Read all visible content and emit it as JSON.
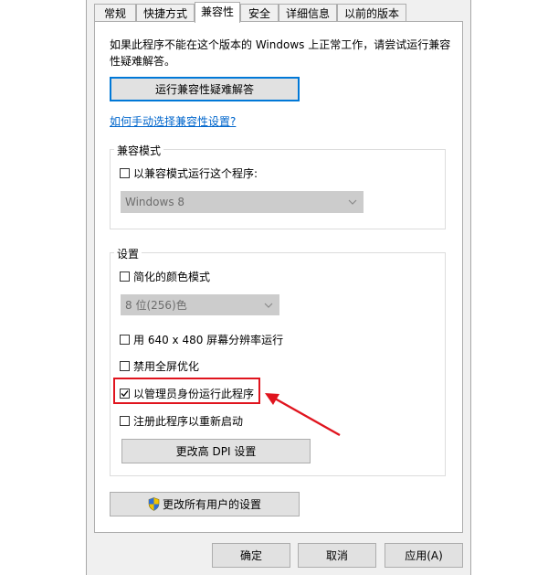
{
  "tabs": [
    {
      "label": "常规"
    },
    {
      "label": "快捷方式"
    },
    {
      "label": "兼容性"
    },
    {
      "label": "安全"
    },
    {
      "label": "详细信息"
    },
    {
      "label": "以前的版本"
    }
  ],
  "compat": {
    "description": "如果此程序不能在这个版本的 Windows 上正常工作，请尝试运行兼容性疑难解答。",
    "run_troubleshooter": "运行兼容性疑难解答",
    "manual_link": "如何手动选择兼容性设置?"
  },
  "mode_group": {
    "legend": "兼容模式",
    "checkbox_label": "以兼容模式运行这个程序:",
    "checked": false,
    "os_value": "Windows 8"
  },
  "settings_group": {
    "legend": "设置",
    "reduced_color": {
      "label": "简化的颜色模式",
      "checked": false
    },
    "color_value": "8 位(256)色",
    "low_res": {
      "label": "用 640 x 480 屏幕分辨率运行",
      "checked": false
    },
    "disable_fullscreen": {
      "label": "禁用全屏优化",
      "checked": false
    },
    "run_as_admin": {
      "label": "以管理员身份运行此程序",
      "checked": true
    },
    "register_restart": {
      "label": "注册此程序以重新启动",
      "checked": false
    },
    "dpi_button": "更改高 DPI 设置"
  },
  "all_users_button": "更改所有用户的设置",
  "footer": {
    "ok": "确定",
    "cancel": "取消",
    "apply": "应用(A)"
  },
  "colors": {
    "highlight": "#e0141e",
    "link": "#0066cc",
    "focus": "#0078d7"
  }
}
